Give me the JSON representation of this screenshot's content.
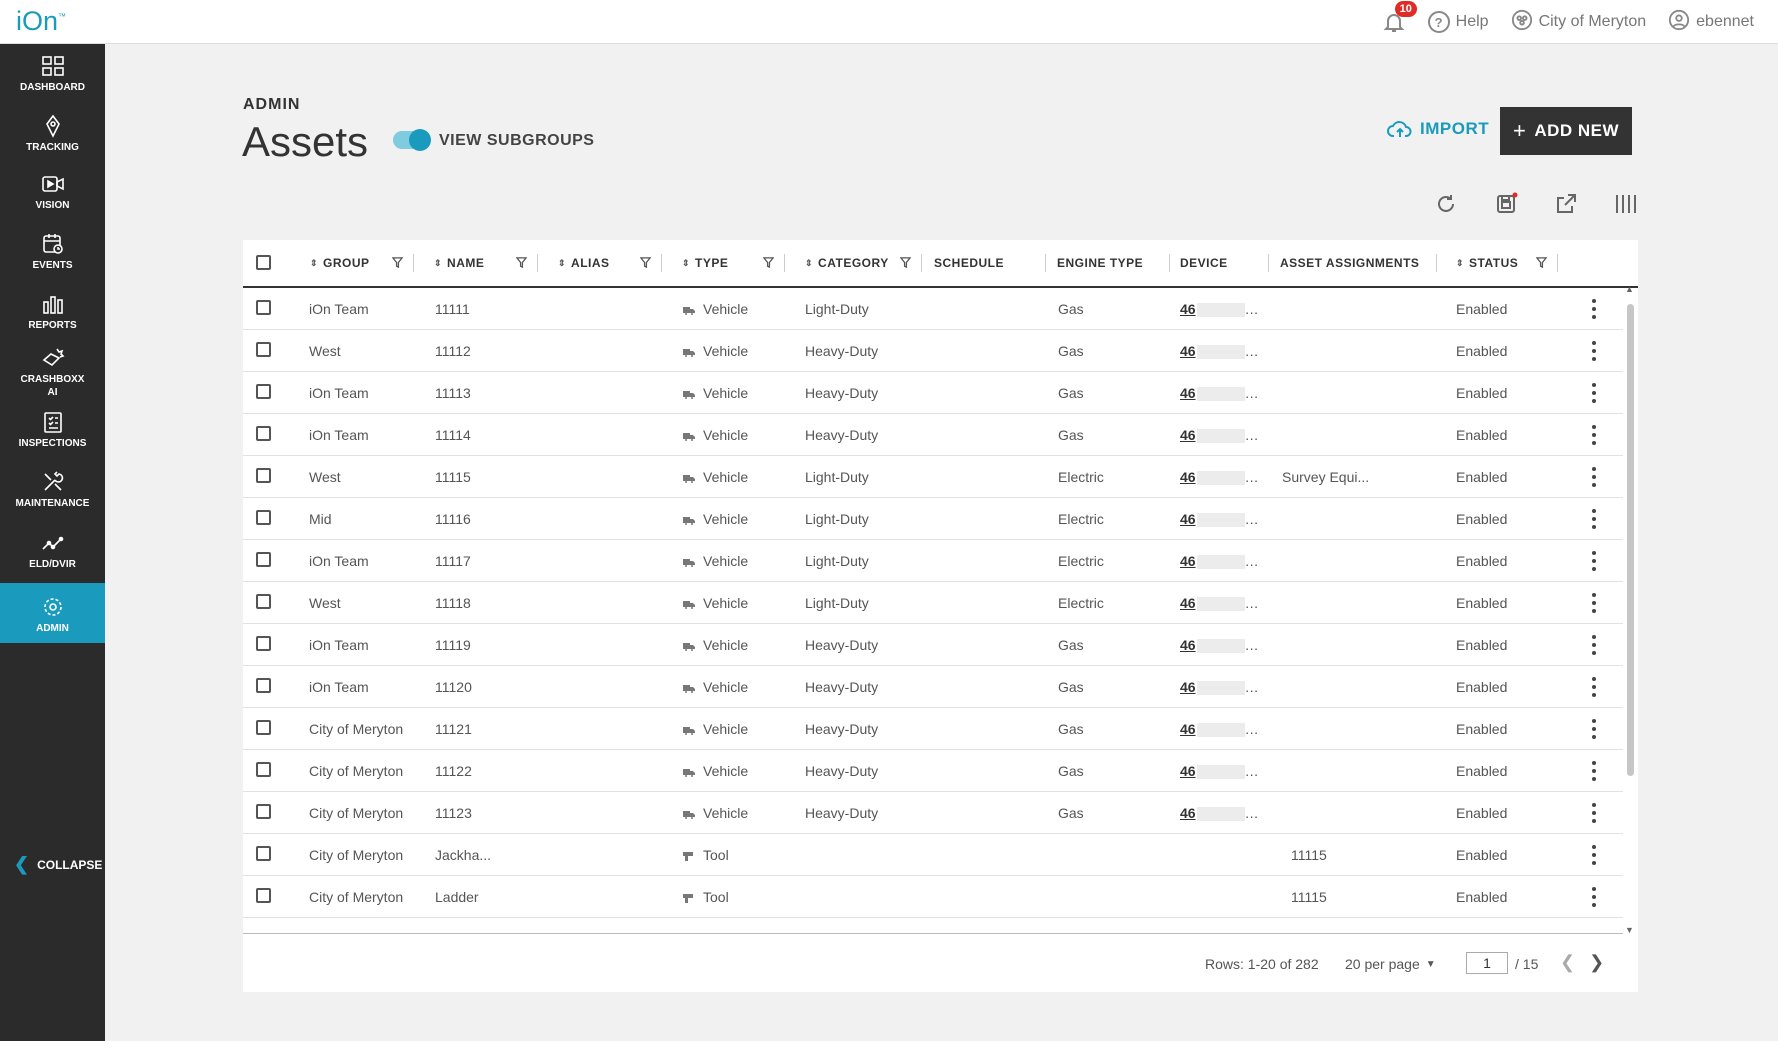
{
  "app": {
    "logo": "iOn",
    "logo_mark": "™"
  },
  "topbar": {
    "notifications_count": "10",
    "help": "Help",
    "org": "City of Meryton",
    "user": "ebennet"
  },
  "sidebar": {
    "items": [
      {
        "label": "DASHBOARD",
        "icon": "dashboard-icon"
      },
      {
        "label": "TRACKING",
        "icon": "tracking-icon"
      },
      {
        "label": "VISION",
        "icon": "vision-icon"
      },
      {
        "label": "EVENTS",
        "icon": "events-icon"
      },
      {
        "label": "REPORTS",
        "icon": "reports-icon"
      },
      {
        "label": "CRASHBOXX AI",
        "label_line1": "CRASHBOXX",
        "label_line2": "AI",
        "icon": "crashboxx-icon"
      },
      {
        "label": "INSPECTIONS",
        "icon": "inspections-icon"
      },
      {
        "label": "MAINTENANCE",
        "icon": "maintenance-icon"
      },
      {
        "label": "ELD/DVIR",
        "icon": "eld-icon"
      },
      {
        "label": "ADMIN",
        "icon": "gear-icon",
        "active": true
      }
    ],
    "collapse": "COLLAPSE"
  },
  "header": {
    "section": "ADMIN",
    "title": "Assets",
    "toggle_label": "VIEW SUBGROUPS",
    "toggle_on": true,
    "import": "IMPORT",
    "add_new": "ADD NEW"
  },
  "table": {
    "columns": [
      "GROUP",
      "NAME",
      "ALIAS",
      "TYPE",
      "CATEGORY",
      "SCHEDULE",
      "ENGINE TYPE",
      "DEVICE",
      "ASSET ASSIGNMENTS",
      "STATUS"
    ],
    "rows": [
      {
        "group": "iOn Team",
        "name": "11111",
        "alias": "",
        "type": "Vehicle",
        "category": "Light-Duty",
        "engine": "Gas",
        "device": "46",
        "assign": "",
        "status": "Enabled"
      },
      {
        "group": "West",
        "name": "11112",
        "alias": "",
        "type": "Vehicle",
        "category": "Heavy-Duty",
        "engine": "Gas",
        "device": "46",
        "assign": "",
        "status": "Enabled"
      },
      {
        "group": "iOn Team",
        "name": "11113",
        "alias": "",
        "type": "Vehicle",
        "category": "Heavy-Duty",
        "engine": "Gas",
        "device": "46",
        "assign": "",
        "status": "Enabled"
      },
      {
        "group": "iOn Team",
        "name": "11114",
        "alias": "",
        "type": "Vehicle",
        "category": "Heavy-Duty",
        "engine": "Gas",
        "device": "46",
        "assign": "",
        "status": "Enabled"
      },
      {
        "group": "West",
        "name": "11115",
        "alias": "",
        "type": "Vehicle",
        "category": "Light-Duty",
        "engine": "Electric",
        "device": "46",
        "assign": "Survey Equi...",
        "status": "Enabled"
      },
      {
        "group": "Mid",
        "name": "11116",
        "alias": "",
        "type": "Vehicle",
        "category": "Light-Duty",
        "engine": "Electric",
        "device": "46",
        "assign": "",
        "status": "Enabled"
      },
      {
        "group": "iOn Team",
        "name": "11117",
        "alias": "",
        "type": "Vehicle",
        "category": "Light-Duty",
        "engine": "Electric",
        "device": "46",
        "assign": "",
        "status": "Enabled"
      },
      {
        "group": "West",
        "name": "11118",
        "alias": "",
        "type": "Vehicle",
        "category": "Light-Duty",
        "engine": "Electric",
        "device": "46",
        "assign": "",
        "status": "Enabled"
      },
      {
        "group": "iOn Team",
        "name": "11119",
        "alias": "",
        "type": "Vehicle",
        "category": "Heavy-Duty",
        "engine": "Gas",
        "device": "46",
        "assign": "",
        "status": "Enabled"
      },
      {
        "group": "iOn Team",
        "name": "11120",
        "alias": "",
        "type": "Vehicle",
        "category": "Heavy-Duty",
        "engine": "Gas",
        "device": "46",
        "assign": "",
        "status": "Enabled"
      },
      {
        "group": "City of Meryton",
        "name": "11121",
        "alias": "",
        "type": "Vehicle",
        "category": "Heavy-Duty",
        "engine": "Gas",
        "device": "46",
        "assign": "",
        "status": "Enabled"
      },
      {
        "group": "City of Meryton",
        "name": "11122",
        "alias": "",
        "type": "Vehicle",
        "category": "Heavy-Duty",
        "engine": "Gas",
        "device": "46",
        "assign": "",
        "status": "Enabled"
      },
      {
        "group": "City of Meryton",
        "name": "11123",
        "alias": "",
        "type": "Vehicle",
        "category": "Heavy-Duty",
        "engine": "Gas",
        "device": "46",
        "assign": "",
        "status": "Enabled"
      },
      {
        "group": "City of Meryton",
        "name": "Jackha...",
        "alias": "",
        "type": "Tool",
        "category": "",
        "engine": "",
        "device": "",
        "assign": "11115",
        "status": "Enabled"
      },
      {
        "group": "City of Meryton",
        "name": "Ladder",
        "alias": "",
        "type": "Tool",
        "category": "",
        "engine": "",
        "device": "",
        "assign": "11115",
        "status": "Enabled"
      }
    ]
  },
  "footer": {
    "rows_info": "Rows: 1-20 of 282",
    "per_page": "20 per page",
    "page": "1",
    "page_total": "/ 15"
  },
  "colors": {
    "accent": "#1a9bbd",
    "sidebar": "#2b2b2b",
    "badge": "#e02b27",
    "button_dark": "#333333"
  }
}
